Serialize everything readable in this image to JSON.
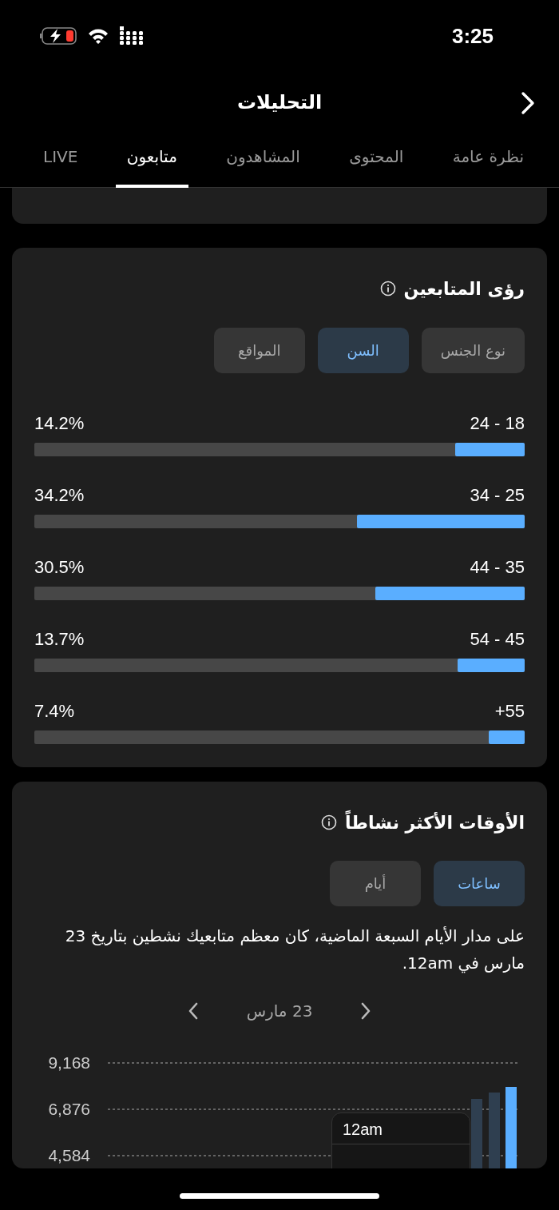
{
  "status_bar": {
    "time": "3:25"
  },
  "header": {
    "title": "التحليلات"
  },
  "tabs": [
    {
      "label": "نظرة عامة",
      "selected": false
    },
    {
      "label": "المحتوى",
      "selected": false
    },
    {
      "label": "المشاهدون",
      "selected": false
    },
    {
      "label": "متابعون",
      "selected": true
    },
    {
      "label": "LIVE",
      "selected": false
    }
  ],
  "follower_insights": {
    "title": "رؤى المتابعين",
    "filters": [
      {
        "label": "نوع الجنس",
        "selected": false
      },
      {
        "label": "السن",
        "selected": true
      },
      {
        "label": "المواقع",
        "selected": false
      }
    ],
    "age_groups": [
      {
        "range": "24 - 18",
        "share": "14.2%",
        "level": 0.142
      },
      {
        "range": "34 - 25",
        "share": "34.2%",
        "level": 0.342
      },
      {
        "range": "44 - 35",
        "share": "30.5%",
        "level": 0.305
      },
      {
        "range": "54 - 45",
        "share": "13.7%",
        "level": 0.137
      },
      {
        "range": "+55",
        "share": "7.4%",
        "level": 0.074
      }
    ]
  },
  "most_active_times": {
    "title": "الأوقات الأكثر نشاطاً",
    "filters": [
      {
        "label": "ساعات",
        "selected": true
      },
      {
        "label": "أيام",
        "selected": false
      }
    ],
    "summary": "على مدار الأيام السبعة الماضية، كان معظم متابعيك نشطين بتاريخ 23 مارس في 12am.",
    "date": "23 مارس",
    "chart_axis_labels": [
      "9,168",
      "6,876",
      "4,584"
    ],
    "tooltip": {
      "label": "12am"
    }
  }
}
